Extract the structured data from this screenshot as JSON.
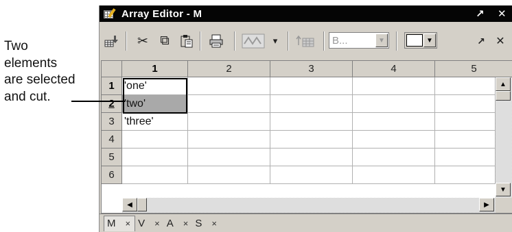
{
  "annotation": {
    "lines": [
      "Two",
      "elements",
      "are selected",
      "and cut."
    ]
  },
  "window": {
    "title": "Array Editor - M",
    "undock_glyph": "↗",
    "close_glyph": "✕"
  },
  "toolbar": {
    "import_icon": "import-data-icon",
    "cut_glyph": "✂",
    "copy_glyph": "⧉",
    "paste_glyph": "📋",
    "print_glyph": "🖶",
    "plot_glyph": "∿",
    "plot_dropdown_glyph": "▾",
    "sort_glyph": "↕",
    "base_combo_value": "B...",
    "combo_arrow": "▼",
    "right_combo_value": "",
    "undock_glyph": "↗",
    "close_glyph": "✕"
  },
  "grid": {
    "columns": [
      "1",
      "2",
      "3",
      "4",
      "5"
    ],
    "active_column": 0,
    "rows": [
      {
        "label": "1",
        "cells": [
          "'one'",
          "",
          "",
          "",
          ""
        ]
      },
      {
        "label": "2",
        "cells": [
          "'two'",
          "",
          "",
          "",
          ""
        ]
      },
      {
        "label": "3",
        "cells": [
          "'three'",
          "",
          "",
          "",
          ""
        ]
      },
      {
        "label": "4",
        "cells": [
          "",
          "",
          "",
          "",
          ""
        ]
      },
      {
        "label": "5",
        "cells": [
          "",
          "",
          "",
          "",
          ""
        ]
      },
      {
        "label": "6",
        "cells": [
          "",
          "",
          "",
          "",
          ""
        ]
      }
    ],
    "selected_rows": [
      0,
      1
    ],
    "active_row": 1
  },
  "scrollbars": {
    "up_arrow": "▲",
    "down_arrow": "▼",
    "left_arrow": "◀",
    "right_arrow": "▶"
  },
  "tabs": [
    {
      "label": "M",
      "close": "×",
      "active": true
    },
    {
      "label": "V",
      "close": "×",
      "active": false
    },
    {
      "label": "A",
      "close": "×",
      "active": false
    },
    {
      "label": "S",
      "close": "×",
      "active": false
    }
  ]
}
